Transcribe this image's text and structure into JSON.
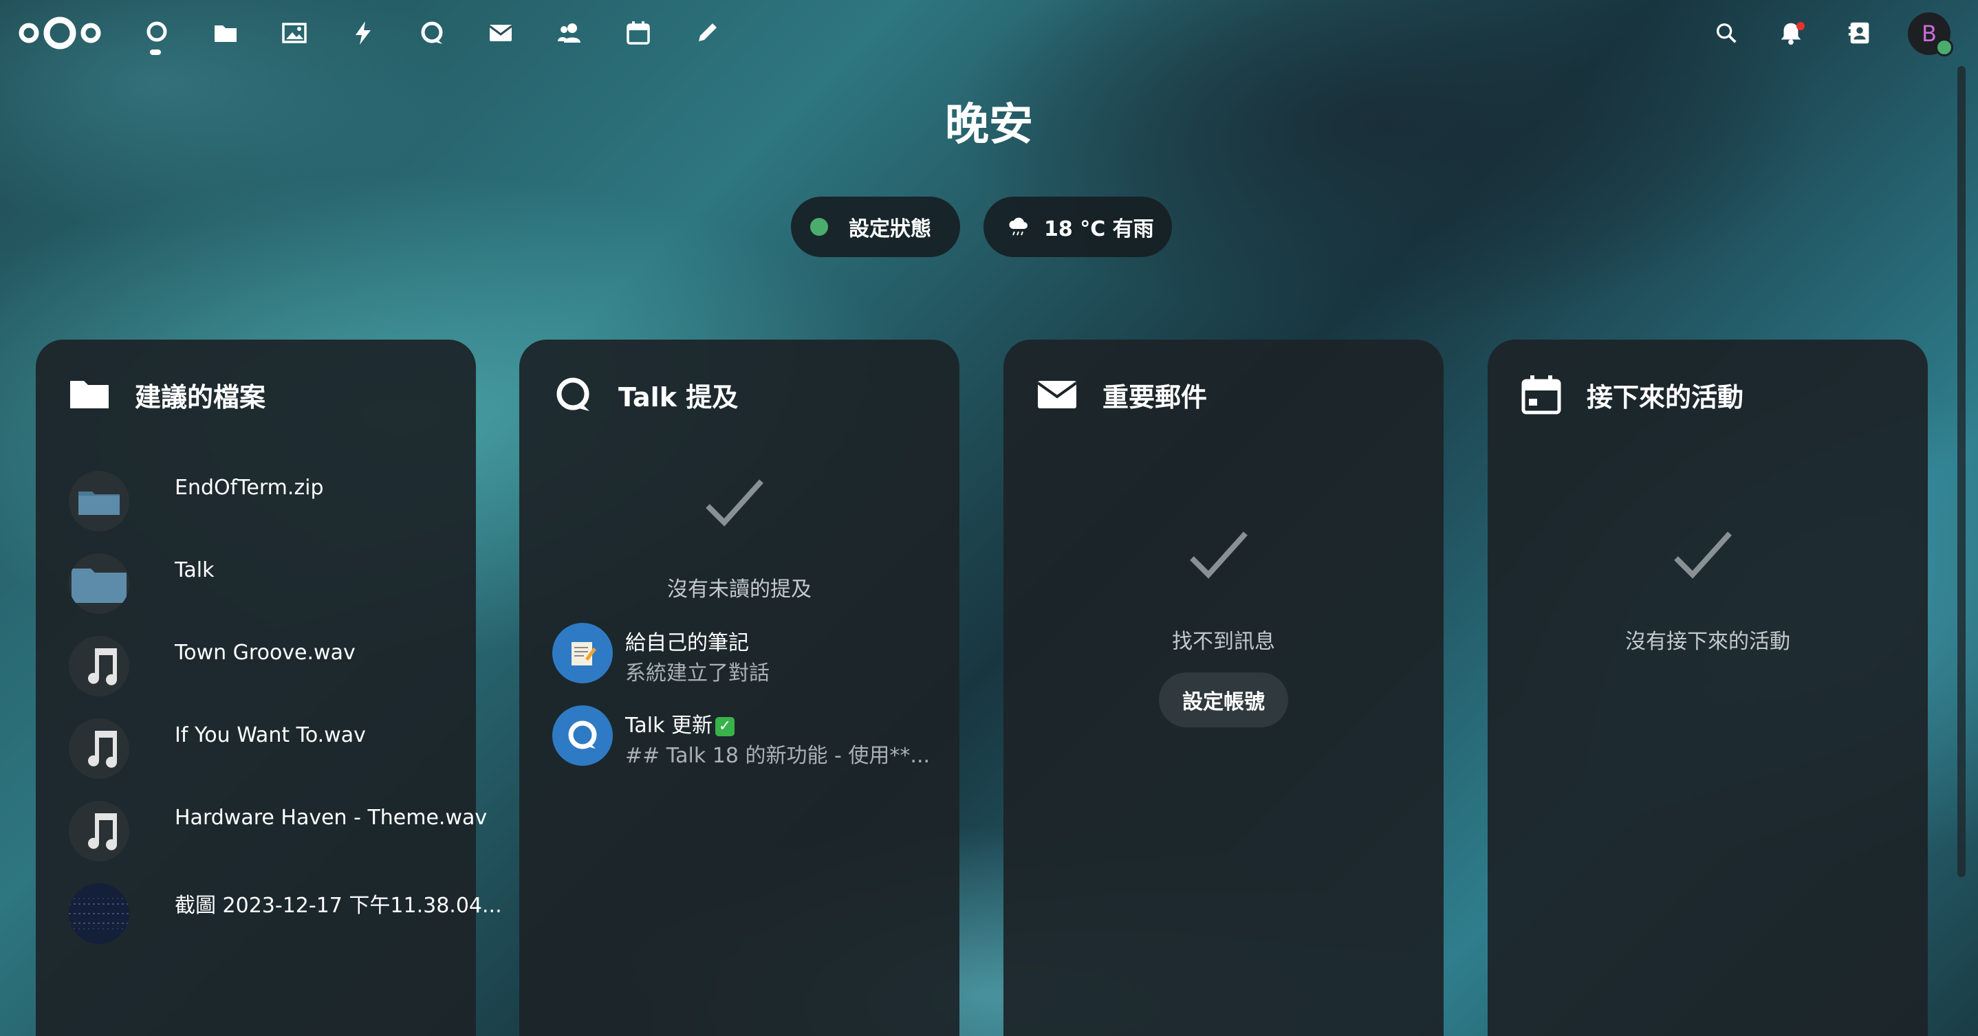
{
  "header": {
    "apps": [
      {
        "name": "dashboard",
        "icon": "dashboard-icon"
      },
      {
        "name": "files",
        "icon": "folder-icon"
      },
      {
        "name": "photos",
        "icon": "image-icon"
      },
      {
        "name": "activity",
        "icon": "lightning-icon"
      },
      {
        "name": "talk",
        "icon": "talk-icon"
      },
      {
        "name": "mail",
        "icon": "mail-icon"
      },
      {
        "name": "contacts",
        "icon": "contacts-icon"
      },
      {
        "name": "calendar",
        "icon": "calendar-icon"
      },
      {
        "name": "notes",
        "icon": "pencil-icon"
      }
    ],
    "avatar_initial": "B"
  },
  "greeting": "晚安",
  "status": {
    "label": "設定狀態",
    "color": "#4aad6e"
  },
  "weather": {
    "label": "18 °C 有雨",
    "icon": "rain-cloud-icon"
  },
  "panels": {
    "files": {
      "title": "建議的檔案",
      "items": [
        {
          "name": "EndOfTerm.zip",
          "icon": "archive-icon"
        },
        {
          "name": "Talk",
          "icon": "folder-icon"
        },
        {
          "name": "Town Groove.wav",
          "icon": "music-note-icon"
        },
        {
          "name": "If You Want To.wav",
          "icon": "music-note-icon"
        },
        {
          "name": "Hardware Haven - Theme.wav",
          "icon": "music-note-icon"
        },
        {
          "name": "截圖 2023-12-17 下午11.38.04...",
          "icon": "image-thumbnail"
        }
      ]
    },
    "talk": {
      "title": "Talk 提及",
      "empty_text": "沒有未讀的提及",
      "conversations": [
        {
          "title": "給自己的筆記",
          "subtitle": "系統建立了對話",
          "icon": "note-icon"
        },
        {
          "title": "Talk 更新",
          "subtitle": "## Talk 18 的新功能 - 使用**...",
          "icon": "talk-icon"
        }
      ]
    },
    "mail": {
      "title": "重要郵件",
      "empty_text": "找不到訊息",
      "button_label": "設定帳號"
    },
    "calendar": {
      "title": "接下來的活動",
      "empty_text": "沒有接下來的活動"
    }
  }
}
